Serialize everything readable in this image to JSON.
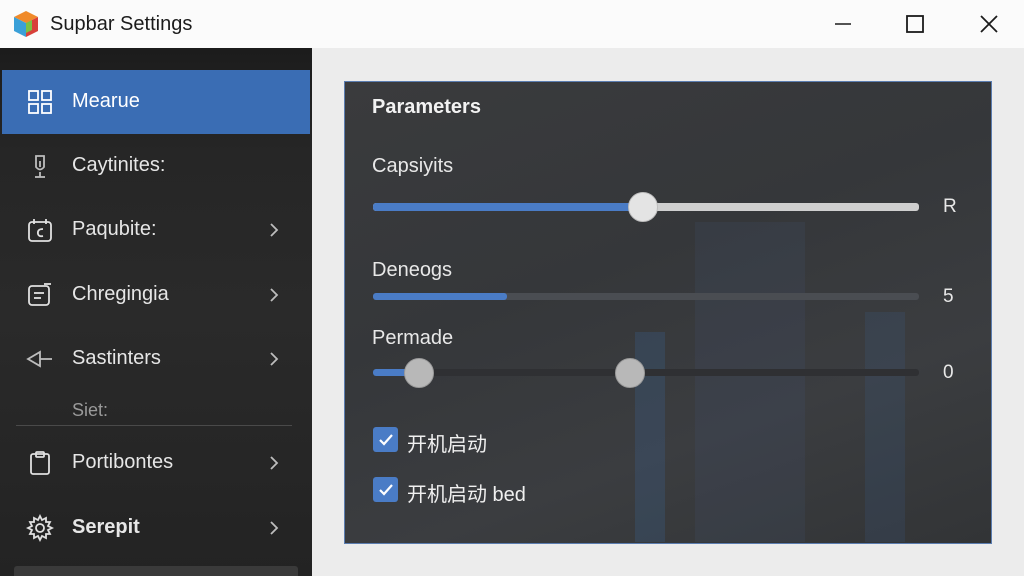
{
  "window": {
    "title": "Supbar Settings"
  },
  "sidebar": {
    "items": [
      {
        "label": "Mearue",
        "icon": "grid-icon",
        "active": true
      },
      {
        "label": "Caytinites:",
        "icon": "pen-icon"
      },
      {
        "label": "Paqubite:",
        "icon": "calendar-icon"
      },
      {
        "label": "Chregingia",
        "icon": "note-icon"
      },
      {
        "label": "Sastinters",
        "icon": "share-icon"
      },
      {
        "label": "Portibontes",
        "icon": "clipboard-icon"
      },
      {
        "label": "Serepit",
        "icon": "gear-icon"
      }
    ],
    "section_label": "Siet:"
  },
  "panel": {
    "title": "Parameters",
    "sliders": [
      {
        "label": "Capsiyits",
        "value": 0.495,
        "value_text": "R"
      },
      {
        "label": "Deneogs",
        "value": 0.245,
        "value_text": "5"
      },
      {
        "label": "Permade",
        "value": 0.085,
        "value2": 0.47,
        "value_text": "0"
      }
    ],
    "checkboxes": [
      {
        "label": "开机启动",
        "checked": true
      },
      {
        "label": "开机启动 bed",
        "checked": true
      }
    ]
  },
  "colors": {
    "accent": "#4a7cc6",
    "sidebar_active": "#3a6db4"
  }
}
